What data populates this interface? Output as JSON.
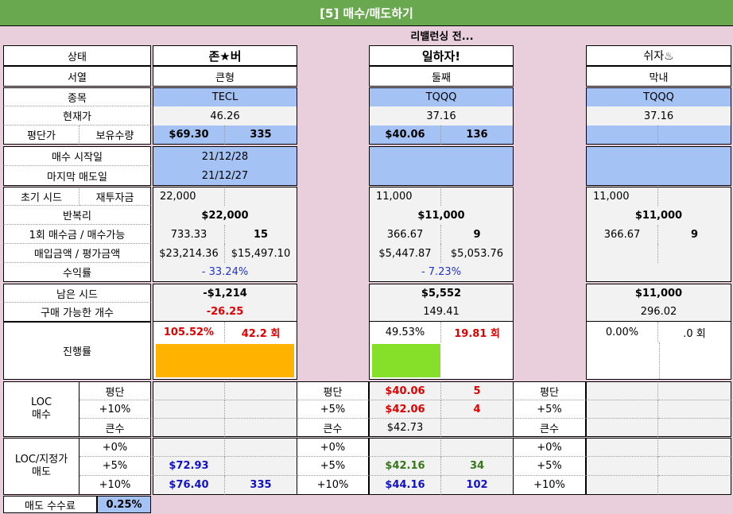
{
  "title": "[5] 매수/매도하기",
  "subtitle": "리밸런싱 전...",
  "labels": {
    "state": "상태",
    "order": "서열",
    "ticker": "종목",
    "price": "현재가",
    "avg": "평단가",
    "qty": "보유수량",
    "buy_start": "매수 시작일",
    "last_sell": "마지막 매도일",
    "init_seed": "초기 시드",
    "reinvest": "재투자금",
    "compound": "반복리",
    "per_buy": "1회 매수금 / 매수가능",
    "buy_eval": "매입금액 / 평가금액",
    "profit": "수익률",
    "remain": "남은 시드",
    "buyable": "구매 가능한 개수",
    "progress": "진행률",
    "loc_buy": "LOC\n매수",
    "loc_sell": "LOC/지정가\n매도",
    "fee": "매도 수수료",
    "fee_value": "0.25%"
  },
  "accounts": [
    {
      "name": "존★버",
      "rank": "큰형",
      "ticker": "TECL",
      "price": "46.26",
      "avg": "$69.30",
      "qty": "335",
      "buy_start": "21/12/28",
      "last_sell": "21/12/27",
      "seed": "22,000",
      "compound": "$22,000",
      "per_buy": "733.33",
      "buyable_n": "15",
      "buy_amt": "$23,214.36",
      "eval_amt": "$15,497.10",
      "profit": "- 33.24%",
      "remain": "-$1,214",
      "count": "-26.25",
      "progress": "105.52%",
      "rounds": "42.2 회",
      "bar_color": "#ffb200",
      "bar_fraction": 1.0,
      "sell_plus5": "$72.93",
      "sell_plus10": "$76.40",
      "sell_plus10_qty": "335"
    },
    {
      "name": "일하자!",
      "rank": "둘째",
      "ticker": "TQQQ",
      "price": "37.16",
      "avg": "$40.06",
      "qty": "136",
      "buy_start": "",
      "last_sell": "",
      "seed": "11,000",
      "compound": "$11,000",
      "per_buy": "366.67",
      "buyable_n": "9",
      "buy_amt": "$5,447.87",
      "eval_amt": "$5,053.76",
      "profit": "- 7.23%",
      "remain": "$5,552",
      "count": "149.41",
      "progress": "49.53%",
      "rounds": "19.81 회",
      "bar_color": "#86e02a",
      "bar_fraction": 0.4953,
      "loc_labels": [
        "평단",
        "+5%",
        "큰수"
      ],
      "loc_avg": "$40.06",
      "loc_avg_qty": "5",
      "loc_plus5": "$42.06",
      "loc_plus5_qty": "4",
      "loc_big": "$42.73",
      "sell_labels": [
        "+0%",
        "+5%",
        "+10%"
      ],
      "sell_plus5": "$42.16",
      "sell_plus5_qty": "34",
      "sell_plus10": "$44.16",
      "sell_plus10_qty": "102"
    },
    {
      "name": "쉬자♨",
      "rank": "막내",
      "ticker": "TQQQ",
      "price": "37.16",
      "seed": "11,000",
      "compound": "$11,000",
      "per_buy": "366.67",
      "buyable_n": "9",
      "remain": "$11,000",
      "count": "296.02",
      "progress": "0.00%",
      "rounds": ".0 회",
      "loc_labels": [
        "평단",
        "+5%",
        "큰수"
      ],
      "sell_labels": [
        "+0%",
        "+5%",
        "+10%"
      ]
    }
  ],
  "loc_rows_first": [
    "평단",
    "+10%",
    "큰수"
  ],
  "sell_rows_first": [
    "+0%",
    "+5%",
    "+10%"
  ]
}
